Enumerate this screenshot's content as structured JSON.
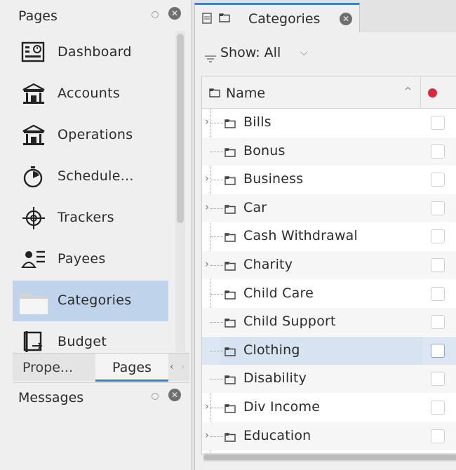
{
  "left_dock": {
    "title": "Pages",
    "pages": [
      {
        "label": "Dashboard",
        "icon": "dashboard-icon",
        "selected": false
      },
      {
        "label": "Accounts",
        "icon": "bank-icon",
        "selected": false
      },
      {
        "label": "Operations",
        "icon": "bank-icon",
        "selected": false
      },
      {
        "label": "Schedule...",
        "icon": "stopwatch-icon",
        "selected": false
      },
      {
        "label": "Trackers",
        "icon": "crosshair-icon",
        "selected": false
      },
      {
        "label": "Payees",
        "icon": "payees-icon",
        "selected": false
      },
      {
        "label": "Categories",
        "icon": "categories-folder-icon",
        "selected": true
      },
      {
        "label": "Budget",
        "icon": "budget-icon",
        "selected": false
      }
    ],
    "tabs": {
      "properties": "Prope...",
      "pages": "Pages"
    },
    "messages_title": "Messages"
  },
  "main": {
    "tab_title": "Categories",
    "filter_label": "Show: All",
    "column_name": "Name",
    "selected_category": "Clothing",
    "categories": [
      {
        "label": "Bills",
        "expandable": true
      },
      {
        "label": "Bonus",
        "expandable": false
      },
      {
        "label": "Business",
        "expandable": true
      },
      {
        "label": "Car",
        "expandable": true
      },
      {
        "label": "Cash Withdrawal",
        "expandable": false
      },
      {
        "label": "Charity",
        "expandable": true
      },
      {
        "label": "Child Care",
        "expandable": false
      },
      {
        "label": "Child Support",
        "expandable": false
      },
      {
        "label": "Clothing",
        "expandable": false
      },
      {
        "label": "Disability",
        "expandable": false
      },
      {
        "label": "Div Income",
        "expandable": true
      },
      {
        "label": "Education",
        "expandable": true
      }
    ]
  },
  "colors": {
    "accent": "#3a81c8",
    "selection": "#bfd3ea",
    "mark_red": "#d8283b"
  }
}
